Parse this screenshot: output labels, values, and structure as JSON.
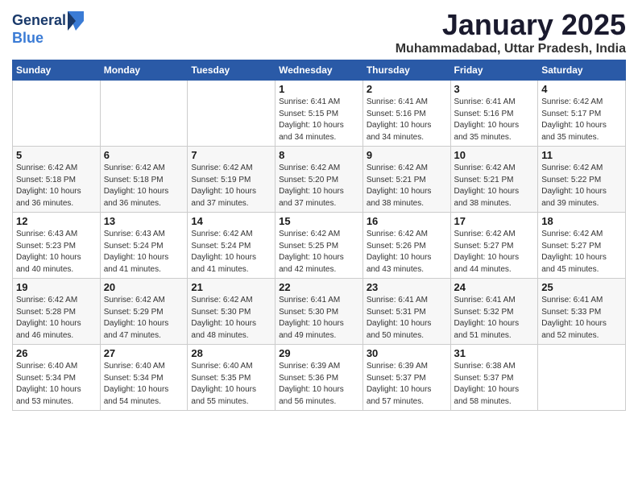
{
  "logo": {
    "general": "General",
    "blue": "Blue"
  },
  "title": "January 2025",
  "location": "Muhammadabad, Uttar Pradesh, India",
  "headers": [
    "Sunday",
    "Monday",
    "Tuesday",
    "Wednesday",
    "Thursday",
    "Friday",
    "Saturday"
  ],
  "weeks": [
    [
      {
        "day": "",
        "info": ""
      },
      {
        "day": "",
        "info": ""
      },
      {
        "day": "",
        "info": ""
      },
      {
        "day": "1",
        "info": "Sunrise: 6:41 AM\nSunset: 5:15 PM\nDaylight: 10 hours\nand 34 minutes."
      },
      {
        "day": "2",
        "info": "Sunrise: 6:41 AM\nSunset: 5:16 PM\nDaylight: 10 hours\nand 34 minutes."
      },
      {
        "day": "3",
        "info": "Sunrise: 6:41 AM\nSunset: 5:16 PM\nDaylight: 10 hours\nand 35 minutes."
      },
      {
        "day": "4",
        "info": "Sunrise: 6:42 AM\nSunset: 5:17 PM\nDaylight: 10 hours\nand 35 minutes."
      }
    ],
    [
      {
        "day": "5",
        "info": "Sunrise: 6:42 AM\nSunset: 5:18 PM\nDaylight: 10 hours\nand 36 minutes."
      },
      {
        "day": "6",
        "info": "Sunrise: 6:42 AM\nSunset: 5:18 PM\nDaylight: 10 hours\nand 36 minutes."
      },
      {
        "day": "7",
        "info": "Sunrise: 6:42 AM\nSunset: 5:19 PM\nDaylight: 10 hours\nand 37 minutes."
      },
      {
        "day": "8",
        "info": "Sunrise: 6:42 AM\nSunset: 5:20 PM\nDaylight: 10 hours\nand 37 minutes."
      },
      {
        "day": "9",
        "info": "Sunrise: 6:42 AM\nSunset: 5:21 PM\nDaylight: 10 hours\nand 38 minutes."
      },
      {
        "day": "10",
        "info": "Sunrise: 6:42 AM\nSunset: 5:21 PM\nDaylight: 10 hours\nand 38 minutes."
      },
      {
        "day": "11",
        "info": "Sunrise: 6:42 AM\nSunset: 5:22 PM\nDaylight: 10 hours\nand 39 minutes."
      }
    ],
    [
      {
        "day": "12",
        "info": "Sunrise: 6:43 AM\nSunset: 5:23 PM\nDaylight: 10 hours\nand 40 minutes."
      },
      {
        "day": "13",
        "info": "Sunrise: 6:43 AM\nSunset: 5:24 PM\nDaylight: 10 hours\nand 41 minutes."
      },
      {
        "day": "14",
        "info": "Sunrise: 6:42 AM\nSunset: 5:24 PM\nDaylight: 10 hours\nand 41 minutes."
      },
      {
        "day": "15",
        "info": "Sunrise: 6:42 AM\nSunset: 5:25 PM\nDaylight: 10 hours\nand 42 minutes."
      },
      {
        "day": "16",
        "info": "Sunrise: 6:42 AM\nSunset: 5:26 PM\nDaylight: 10 hours\nand 43 minutes."
      },
      {
        "day": "17",
        "info": "Sunrise: 6:42 AM\nSunset: 5:27 PM\nDaylight: 10 hours\nand 44 minutes."
      },
      {
        "day": "18",
        "info": "Sunrise: 6:42 AM\nSunset: 5:27 PM\nDaylight: 10 hours\nand 45 minutes."
      }
    ],
    [
      {
        "day": "19",
        "info": "Sunrise: 6:42 AM\nSunset: 5:28 PM\nDaylight: 10 hours\nand 46 minutes."
      },
      {
        "day": "20",
        "info": "Sunrise: 6:42 AM\nSunset: 5:29 PM\nDaylight: 10 hours\nand 47 minutes."
      },
      {
        "day": "21",
        "info": "Sunrise: 6:42 AM\nSunset: 5:30 PM\nDaylight: 10 hours\nand 48 minutes."
      },
      {
        "day": "22",
        "info": "Sunrise: 6:41 AM\nSunset: 5:30 PM\nDaylight: 10 hours\nand 49 minutes."
      },
      {
        "day": "23",
        "info": "Sunrise: 6:41 AM\nSunset: 5:31 PM\nDaylight: 10 hours\nand 50 minutes."
      },
      {
        "day": "24",
        "info": "Sunrise: 6:41 AM\nSunset: 5:32 PM\nDaylight: 10 hours\nand 51 minutes."
      },
      {
        "day": "25",
        "info": "Sunrise: 6:41 AM\nSunset: 5:33 PM\nDaylight: 10 hours\nand 52 minutes."
      }
    ],
    [
      {
        "day": "26",
        "info": "Sunrise: 6:40 AM\nSunset: 5:34 PM\nDaylight: 10 hours\nand 53 minutes."
      },
      {
        "day": "27",
        "info": "Sunrise: 6:40 AM\nSunset: 5:34 PM\nDaylight: 10 hours\nand 54 minutes."
      },
      {
        "day": "28",
        "info": "Sunrise: 6:40 AM\nSunset: 5:35 PM\nDaylight: 10 hours\nand 55 minutes."
      },
      {
        "day": "29",
        "info": "Sunrise: 6:39 AM\nSunset: 5:36 PM\nDaylight: 10 hours\nand 56 minutes."
      },
      {
        "day": "30",
        "info": "Sunrise: 6:39 AM\nSunset: 5:37 PM\nDaylight: 10 hours\nand 57 minutes."
      },
      {
        "day": "31",
        "info": "Sunrise: 6:38 AM\nSunset: 5:37 PM\nDaylight: 10 hours\nand 58 minutes."
      },
      {
        "day": "",
        "info": ""
      }
    ]
  ]
}
